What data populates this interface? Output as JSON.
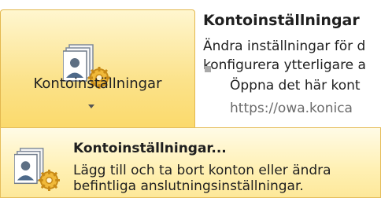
{
  "ribbon_button": {
    "label": "Kontoinställningar",
    "icon": "account-settings-icon"
  },
  "info_panel": {
    "title": "Kontoinställningar",
    "line1": "Ändra inställningar för d",
    "line2": "konfigurera ytterligare a",
    "bullet_text": "Öppna det här kont",
    "url": "https://owa.konica"
  },
  "dropdown_item": {
    "title": "Kontoinställningar...",
    "description": "Lägg till och ta bort konton eller ändra befintliga anslutningsinställningar.",
    "icon": "account-settings-icon"
  },
  "colors": {
    "highlight_border": "#e3b84f",
    "highlight_fill": "#fbe28a",
    "bullet": "#a9a9a9",
    "url_text": "#6b6b6b"
  }
}
